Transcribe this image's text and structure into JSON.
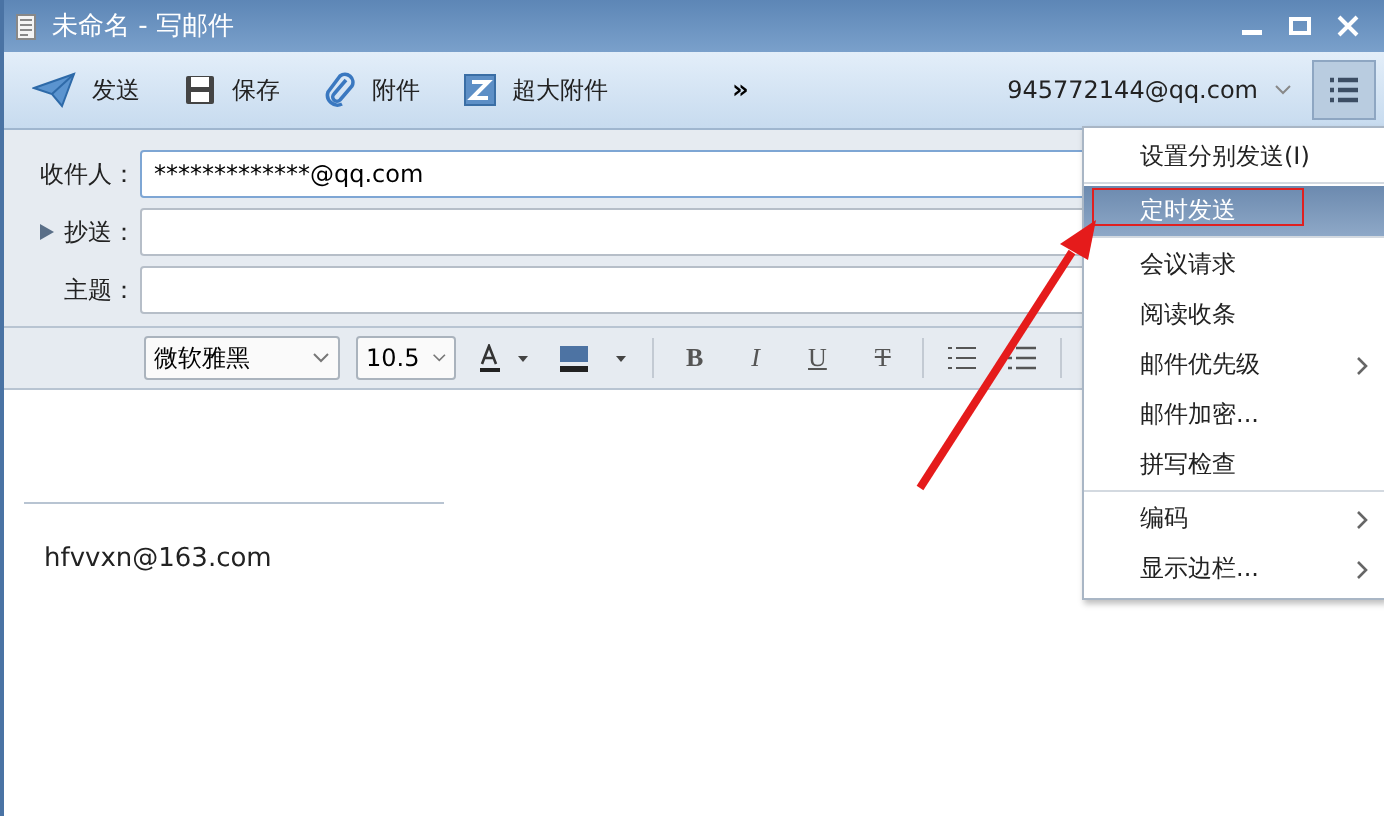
{
  "window": {
    "title": "未命名 - 写邮件"
  },
  "toolbar": {
    "buttons": [
      {
        "kind": "send",
        "label": "发送"
      },
      {
        "kind": "save",
        "label": "保存"
      },
      {
        "kind": "attach",
        "label": "附件"
      },
      {
        "kind": "bigattach",
        "label": "超大附件"
      }
    ],
    "more": "»",
    "account": "945772144@qq.com"
  },
  "fields": [
    {
      "label": "收件人：",
      "value": "*************@qq.com",
      "expandable": false
    },
    {
      "label": "抄送：",
      "expandable": true
    },
    {
      "label": "主题：",
      "expandable": false
    }
  ],
  "format_bar": {
    "font": "微软雅黑",
    "size": "10.5",
    "bold": "B",
    "italic": "I",
    "underline": "U",
    "strike": "T"
  },
  "body": {
    "signature": "hfvvxn@163.com"
  },
  "menu": {
    "items": [
      {
        "label": "设置分别发送(I)",
        "selected": false,
        "submenu": false,
        "divider_after": true
      },
      {
        "label": "定时发送",
        "selected": true,
        "submenu": false,
        "divider_after": true
      },
      {
        "label": "会议请求",
        "selected": false,
        "submenu": false,
        "divider_after": false
      },
      {
        "label": "阅读收条",
        "selected": false,
        "submenu": false,
        "divider_after": false
      },
      {
        "label": "邮件优先级",
        "selected": false,
        "submenu": true,
        "divider_after": false
      },
      {
        "label": "邮件加密...",
        "selected": false,
        "submenu": false,
        "divider_after": false
      },
      {
        "label": "拼写检查",
        "selected": false,
        "submenu": false,
        "divider_after": true
      },
      {
        "label": "编码",
        "selected": false,
        "submenu": true,
        "divider_after": false
      },
      {
        "label": "显示边栏...",
        "selected": false,
        "submenu": true,
        "divider_after": false
      }
    ]
  }
}
